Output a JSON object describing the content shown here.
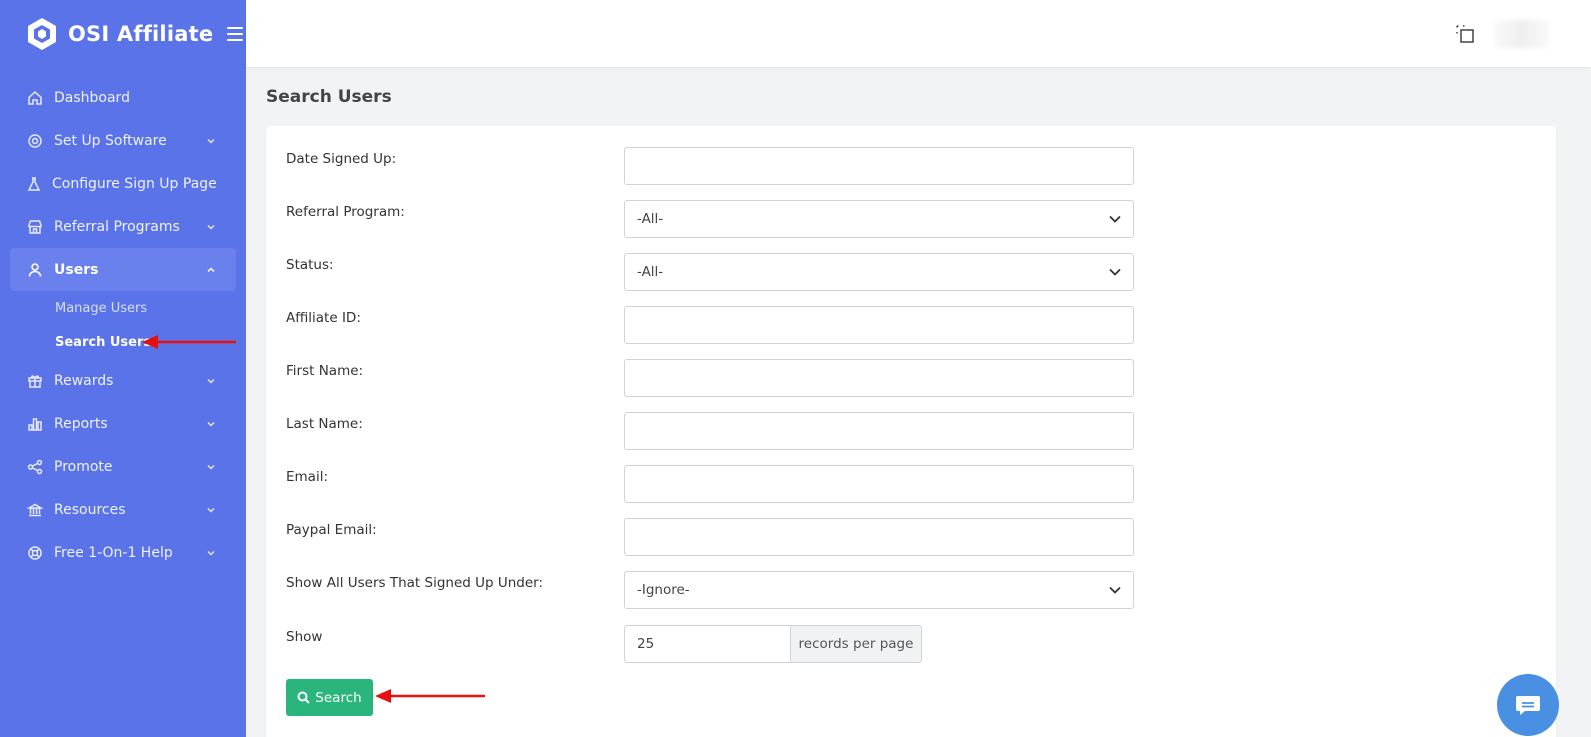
{
  "brand": {
    "name": "OSI Affiliate"
  },
  "sidebar": {
    "items": [
      {
        "label": "Dashboard",
        "icon": "home-icon"
      },
      {
        "label": "Set Up Software",
        "icon": "gear-icon"
      },
      {
        "label": "Configure Sign Up Page",
        "icon": "flask-icon"
      },
      {
        "label": "Referral Programs",
        "icon": "store-icon"
      },
      {
        "label": "Users",
        "icon": "user-icon"
      },
      {
        "label": "Rewards",
        "icon": "gift-icon"
      },
      {
        "label": "Reports",
        "icon": "bar-chart-icon"
      },
      {
        "label": "Promote",
        "icon": "share-icon"
      },
      {
        "label": "Resources",
        "icon": "bank-icon"
      },
      {
        "label": "Free 1-On-1 Help",
        "icon": "lifebuoy-icon"
      }
    ],
    "users_submenu": [
      "Manage Users",
      "Search Users"
    ]
  },
  "page": {
    "title": "Search Users"
  },
  "form": {
    "date_signed_up": {
      "label": "Date Signed Up:",
      "value": ""
    },
    "referral_program": {
      "label": "Referral Program:",
      "value": "-All-"
    },
    "status": {
      "label": "Status:",
      "value": "-All-"
    },
    "affiliate_id": {
      "label": "Affiliate ID:",
      "value": ""
    },
    "first_name": {
      "label": "First Name:",
      "value": ""
    },
    "last_name": {
      "label": "Last Name:",
      "value": ""
    },
    "email": {
      "label": "Email:",
      "value": ""
    },
    "paypal_email": {
      "label": "Paypal Email:",
      "value": ""
    },
    "signed_up_under": {
      "label": "Show All Users That Signed Up Under:",
      "value": "-Ignore-"
    },
    "show": {
      "label": "Show",
      "value": "25",
      "addon": "records per page"
    },
    "search_button": "Search"
  },
  "colors": {
    "sidebar_bg": "#5b73e8",
    "active_item_bg": "#6a80ec",
    "search_button": "#2ab57d",
    "annotation_arrow": "#e8100f",
    "chat_bubble": "#4a90e2"
  }
}
